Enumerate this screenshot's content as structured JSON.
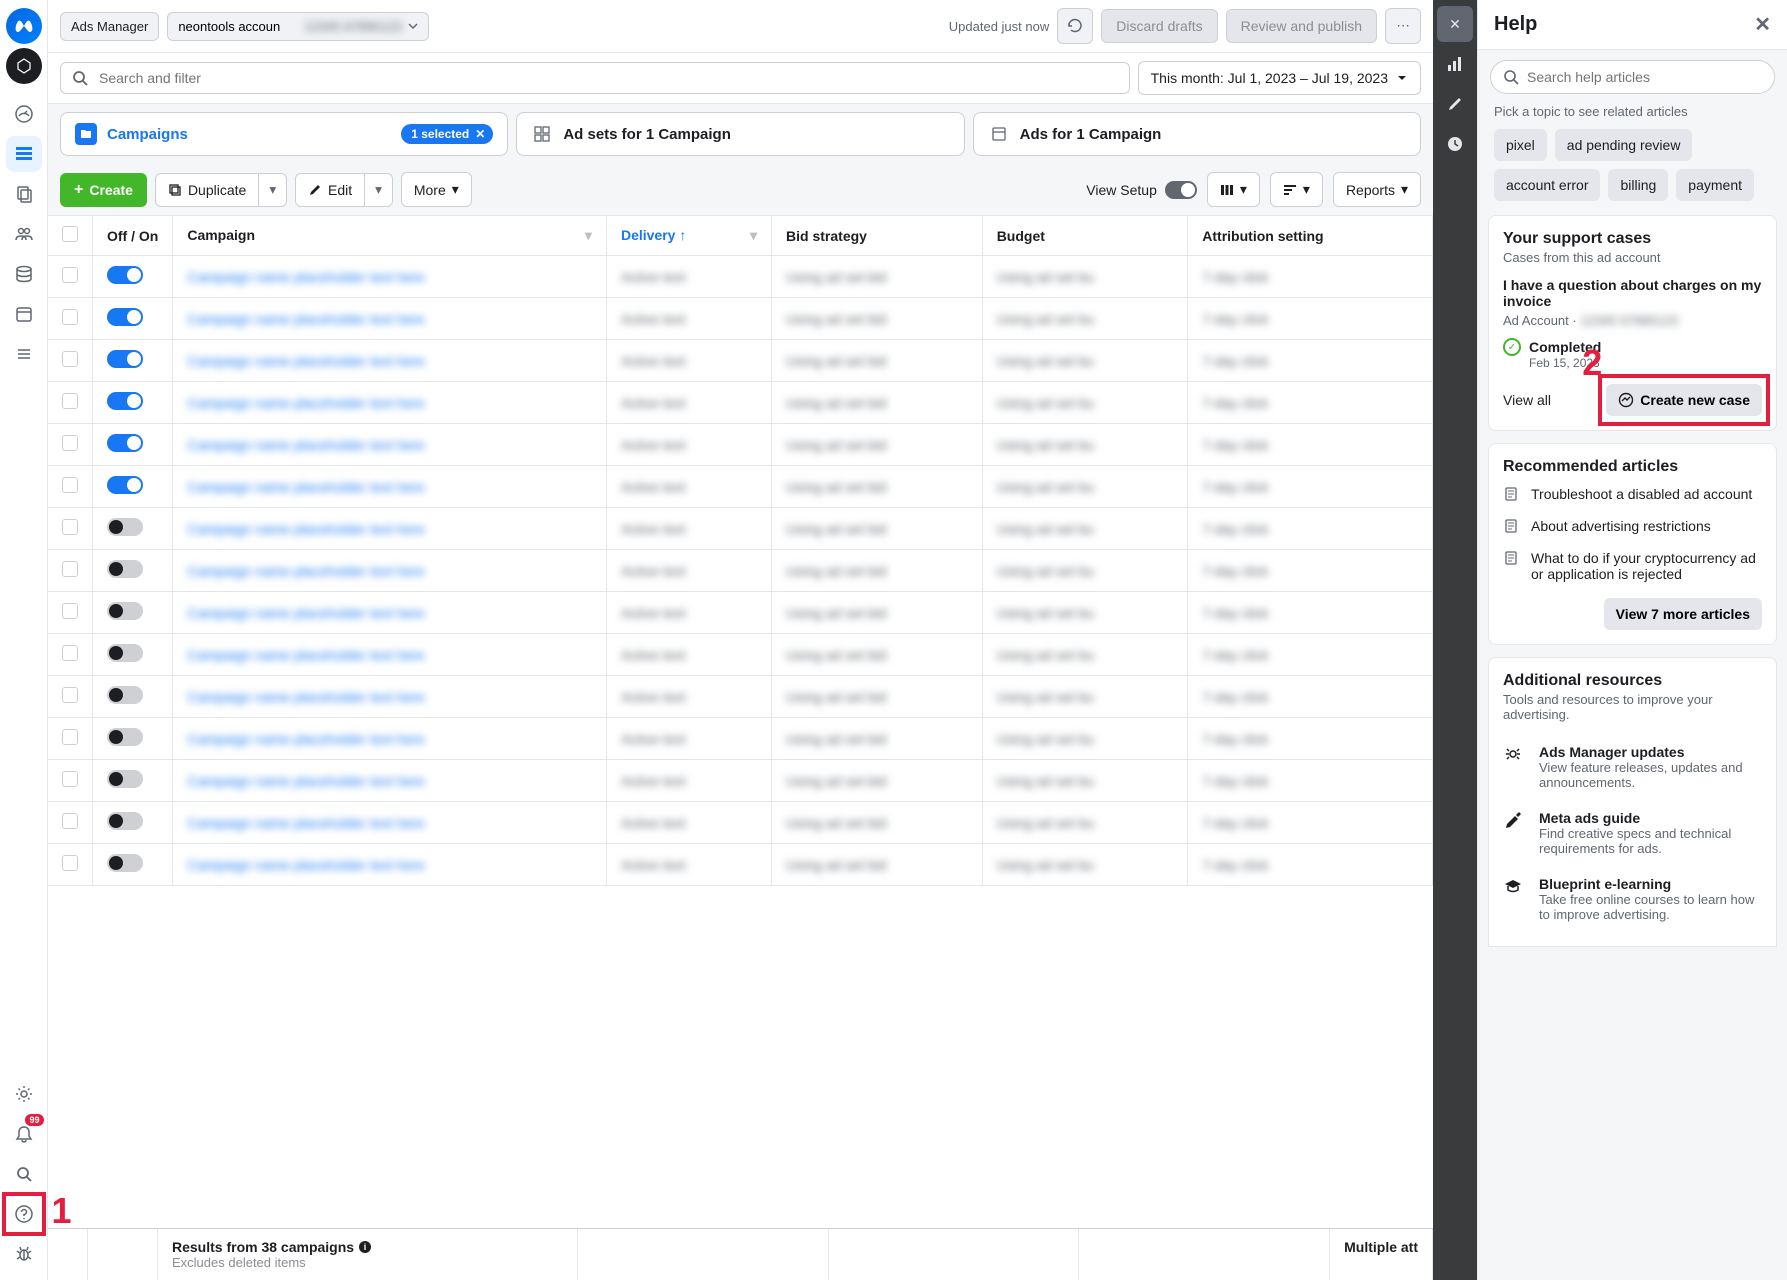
{
  "topbar": {
    "app_name": "Ads Manager",
    "account_name": "neontools accoun",
    "updated": "Updated just now",
    "discard": "Discard drafts",
    "review": "Review and publish"
  },
  "search": {
    "placeholder": "Search and filter",
    "date_range": "This month: Jul 1, 2023 – Jul 19, 2023"
  },
  "tabs": {
    "campaigns": "Campaigns",
    "selected_pill": "1 selected",
    "adsets": "Ad sets for 1 Campaign",
    "ads": "Ads for 1 Campaign"
  },
  "toolbar": {
    "create": "Create",
    "duplicate": "Duplicate",
    "edit": "Edit",
    "more": "More",
    "view_setup": "View Setup",
    "reports": "Reports"
  },
  "columns": {
    "offon": "Off / On",
    "campaign": "Campaign",
    "delivery": "Delivery",
    "bid": "Bid strategy",
    "budget": "Budget",
    "attribution": "Attribution setting"
  },
  "rows": [
    {
      "on": true
    },
    {
      "on": true
    },
    {
      "on": true
    },
    {
      "on": true
    },
    {
      "on": true
    },
    {
      "on": true
    },
    {
      "on": false
    },
    {
      "on": false
    },
    {
      "on": false
    },
    {
      "on": false
    },
    {
      "on": false
    },
    {
      "on": false
    },
    {
      "on": false
    },
    {
      "on": false
    },
    {
      "on": false
    }
  ],
  "footer": {
    "results_title": "Results from 38 campaigns",
    "results_sub": "Excludes deleted items",
    "multiple": "Multiple att"
  },
  "help": {
    "title": "Help",
    "search_placeholder": "Search help articles",
    "pick_topic": "Pick a topic to see related articles",
    "topics": [
      "pixel",
      "ad pending review",
      "account error",
      "billing",
      "payment"
    ],
    "support": {
      "heading": "Your support cases",
      "sub": "Cases from this ad account",
      "case_title": "I have a question about charges on my invoice",
      "case_sub": "Ad Account ·",
      "status": "Completed",
      "status_date": "Feb 15, 2023",
      "view_all": "View all",
      "create_case": "Create new case"
    },
    "recommended": {
      "heading": "Recommended articles",
      "articles": [
        "Troubleshoot a disabled ad account",
        "About advertising restrictions",
        "What to do if your cryptocurrency ad or application is rejected"
      ],
      "more": "View 7 more articles"
    },
    "resources": {
      "heading": "Additional resources",
      "sub": "Tools and resources to improve your advertising.",
      "items": [
        {
          "title": "Ads Manager updates",
          "desc": "View feature releases, updates and announcements."
        },
        {
          "title": "Meta ads guide",
          "desc": "Find creative specs and technical requirements for ads."
        },
        {
          "title": "Blueprint e-learning",
          "desc": "Take free online courses to learn how to improve advertising."
        }
      ]
    }
  },
  "rail_badge": "99"
}
